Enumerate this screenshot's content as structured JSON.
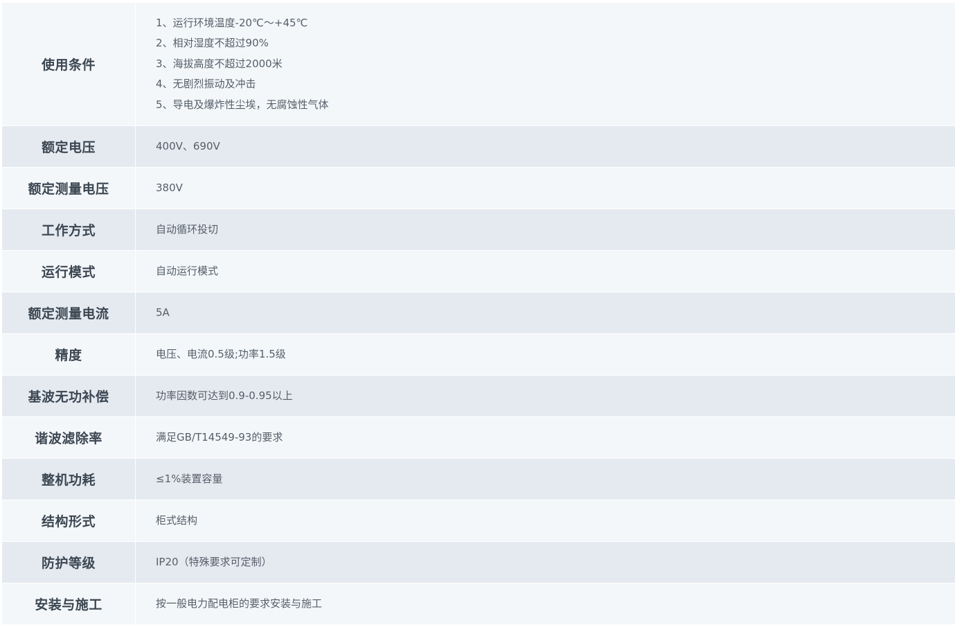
{
  "spec_table": {
    "rows": [
      {
        "label": "使用条件",
        "lines": [
          "1、运行环境温度-20℃～+45℃",
          "2、相对湿度不超过90%",
          "3、海拔高度不超过2000米",
          "4、无剧烈振动及冲击",
          "5、导电及爆炸性尘埃，无腐蚀性气体"
        ]
      },
      {
        "label": "额定电压",
        "lines": [
          "400V、690V"
        ]
      },
      {
        "label": "额定测量电压",
        "lines": [
          "380V"
        ]
      },
      {
        "label": "工作方式",
        "lines": [
          "自动循环投切"
        ]
      },
      {
        "label": "运行模式",
        "lines": [
          "自动运行模式"
        ]
      },
      {
        "label": "额定测量电流",
        "lines": [
          "5A"
        ]
      },
      {
        "label": "精度",
        "lines": [
          "电压、电流0.5级;功率1.5级"
        ]
      },
      {
        "label": "基波无功补偿",
        "lines": [
          "功率因数可达到0.9-0.95以上"
        ]
      },
      {
        "label": "谐波滤除率",
        "lines": [
          "满足GB/T14549-93的要求"
        ]
      },
      {
        "label": "整机功耗",
        "lines": [
          "≤1%装置容量"
        ]
      },
      {
        "label": "结构形式",
        "lines": [
          "柜式结构"
        ]
      },
      {
        "label": "防护等级",
        "lines": [
          "IP20（特殊要求可定制）"
        ]
      },
      {
        "label": "安装与施工",
        "lines": [
          "按一般电力配电柜的要求安装与施工"
        ]
      }
    ]
  },
  "colors": {
    "row_light": "#f4f7fa",
    "row_dark": "#e5eaf1",
    "label_text": "#3b4651",
    "value_text": "#555e68"
  }
}
